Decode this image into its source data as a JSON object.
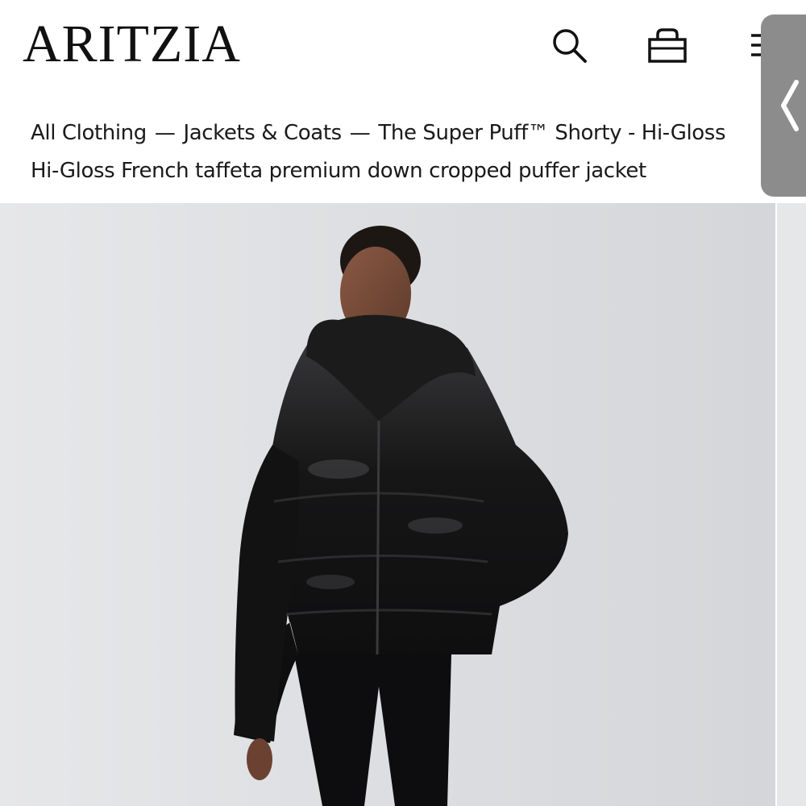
{
  "header": {
    "logo": "ARITZIA",
    "search_icon": "search-icon",
    "bag_icon": "shopping-bag-icon",
    "menu_icon": "menu-icon"
  },
  "breadcrumb": {
    "items": [
      "All Clothing",
      "Jackets & Coats",
      "The Super Puff™ Shorty - Hi-Gloss"
    ],
    "separator": "—",
    "subtitle": "Hi-Gloss French taffeta premium down cropped puffer jacket"
  },
  "side_panel": {
    "icon": "chevron-left-icon"
  },
  "colors": {
    "accent": "#111111",
    "hero_background": "#dcdde0",
    "side_tab": "#8c8c8c",
    "jacket": "#141414"
  }
}
